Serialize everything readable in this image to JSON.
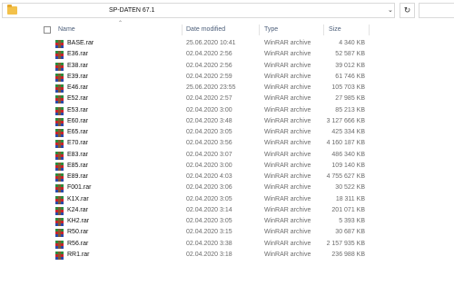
{
  "address_bar": {
    "path": "SP-DATEN 67.1",
    "folder_icon": "folder-icon",
    "chevron_icon": "chevron-down-icon",
    "refresh_icon": "refresh-icon"
  },
  "columns": {
    "name": "Name",
    "date": "Date modified",
    "type": "Type",
    "size": "Size",
    "sort_icon": "chevron-up-icon"
  },
  "file_icon": "winrar-archive-icon",
  "files": [
    {
      "name": "BASE.rar",
      "date": "25.06.2020 10:41",
      "type": "WinRAR archive",
      "size": "4 340 KB"
    },
    {
      "name": "E36.rar",
      "date": "02.04.2020 2:56",
      "type": "WinRAR archive",
      "size": "52 587 KB"
    },
    {
      "name": "E38.rar",
      "date": "02.04.2020 2:56",
      "type": "WinRAR archive",
      "size": "39 012 KB"
    },
    {
      "name": "E39.rar",
      "date": "02.04.2020 2:59",
      "type": "WinRAR archive",
      "size": "61 746 KB"
    },
    {
      "name": "E46.rar",
      "date": "25.06.2020 23:55",
      "type": "WinRAR archive",
      "size": "105 703 KB"
    },
    {
      "name": "E52.rar",
      "date": "02.04.2020 2:57",
      "type": "WinRAR archive",
      "size": "27 985 KB"
    },
    {
      "name": "E53.rar",
      "date": "02.04.2020 3:00",
      "type": "WinRAR archive",
      "size": "85 213 KB"
    },
    {
      "name": "E60.rar",
      "date": "02.04.2020 3:48",
      "type": "WinRAR archive",
      "size": "3 127 666 KB"
    },
    {
      "name": "E65.rar",
      "date": "02.04.2020 3:05",
      "type": "WinRAR archive",
      "size": "425 334 KB"
    },
    {
      "name": "E70.rar",
      "date": "02.04.2020 3:56",
      "type": "WinRAR archive",
      "size": "4 160 187 KB"
    },
    {
      "name": "E83.rar",
      "date": "02.04.2020 3:07",
      "type": "WinRAR archive",
      "size": "486 340 KB"
    },
    {
      "name": "E85.rar",
      "date": "02.04.2020 3:00",
      "type": "WinRAR archive",
      "size": "109 140 KB"
    },
    {
      "name": "E89.rar",
      "date": "02.04.2020 4:03",
      "type": "WinRAR archive",
      "size": "4 755 627 KB"
    },
    {
      "name": "F001.rar",
      "date": "02.04.2020 3:06",
      "type": "WinRAR archive",
      "size": "30 522 KB"
    },
    {
      "name": "K1X.rar",
      "date": "02.04.2020 3:05",
      "type": "WinRAR archive",
      "size": "18 311 KB"
    },
    {
      "name": "K24.rar",
      "date": "02.04.2020 3:14",
      "type": "WinRAR archive",
      "size": "201 071 KB"
    },
    {
      "name": "KH2.rar",
      "date": "02.04.2020 3:05",
      "type": "WinRAR archive",
      "size": "5 393 KB"
    },
    {
      "name": "R50.rar",
      "date": "02.04.2020 3:15",
      "type": "WinRAR archive",
      "size": "30 687 KB"
    },
    {
      "name": "R56.rar",
      "date": "02.04.2020 3:38",
      "type": "WinRAR archive",
      "size": "2 157 935 KB"
    },
    {
      "name": "RR1.rar",
      "date": "02.04.2020 3:18",
      "type": "WinRAR archive",
      "size": "236 988 KB"
    }
  ]
}
